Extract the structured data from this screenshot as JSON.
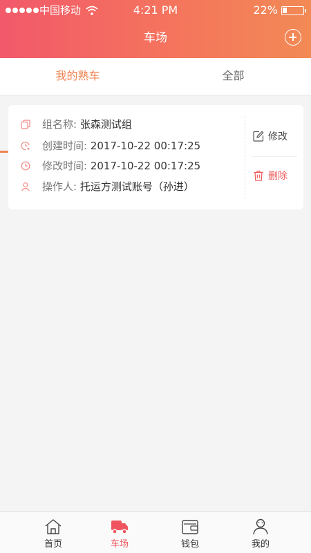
{
  "status_bar": {
    "carrier": "中国移动",
    "time": "4:21 PM",
    "battery_percent": "22%",
    "battery_level": 0.22
  },
  "nav": {
    "title": "车场",
    "add_icon": "plus-circle-icon"
  },
  "tabs": [
    {
      "label": "我的熟车",
      "active": true
    },
    {
      "label": "全部",
      "active": false
    }
  ],
  "card": {
    "rows": [
      {
        "icon": "copy-icon",
        "label": "组名称:",
        "value": "张森测试组"
      },
      {
        "icon": "clock-add-icon",
        "label": "创建时间:",
        "value": "2017-10-22 00:17:25"
      },
      {
        "icon": "clock-icon",
        "label": "修改时间:",
        "value": "2017-10-22 00:17:25"
      },
      {
        "icon": "user-icon",
        "label": "操作人:",
        "value": "托运方测试账号（孙进）"
      }
    ],
    "edit_label": "修改",
    "delete_label": "删除"
  },
  "tabbar": {
    "items": [
      {
        "label": "首页",
        "icon": "home-icon"
      },
      {
        "label": "车场",
        "icon": "truck-icon",
        "active": true
      },
      {
        "label": "钱包",
        "icon": "wallet-icon"
      },
      {
        "label": "我的",
        "icon": "profile-icon"
      }
    ]
  },
  "colors": {
    "header_start": "#f2596a",
    "header_end": "#f28a55",
    "accent": "#f0824f",
    "delete": "#ee5a5a",
    "tab_active": "#f0555f"
  }
}
